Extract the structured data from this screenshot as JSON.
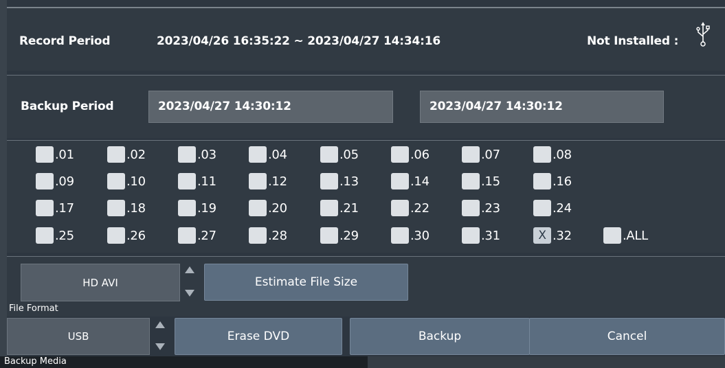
{
  "record": {
    "label": "Record Period",
    "period": "2023/04/26 16:35:22 ~ 2023/04/27 14:34:16",
    "usb_status": "Not Installed :",
    "usb_icon": "usb-icon"
  },
  "backup": {
    "label": "Backup Period",
    "start": "2023/04/27 14:30:12",
    "end": "2023/04/27 14:30:12"
  },
  "channels": {
    "items": [
      {
        "label": ".01",
        "mark": ""
      },
      {
        "label": ".02",
        "mark": ""
      },
      {
        "label": ".03",
        "mark": ""
      },
      {
        "label": ".04",
        "mark": ""
      },
      {
        "label": ".05",
        "mark": ""
      },
      {
        "label": ".06",
        "mark": ""
      },
      {
        "label": ".07",
        "mark": ""
      },
      {
        "label": ".08",
        "mark": ""
      },
      {
        "label": ".09",
        "mark": ""
      },
      {
        "label": ".10",
        "mark": ""
      },
      {
        "label": ".11",
        "mark": ""
      },
      {
        "label": ".12",
        "mark": ""
      },
      {
        "label": ".13",
        "mark": ""
      },
      {
        "label": ".14",
        "mark": ""
      },
      {
        "label": ".15",
        "mark": ""
      },
      {
        "label": ".16",
        "mark": ""
      },
      {
        "label": ".17",
        "mark": ""
      },
      {
        "label": ".18",
        "mark": ""
      },
      {
        "label": ".19",
        "mark": ""
      },
      {
        "label": ".20",
        "mark": ""
      },
      {
        "label": ".21",
        "mark": ""
      },
      {
        "label": ".22",
        "mark": ""
      },
      {
        "label": ".23",
        "mark": ""
      },
      {
        "label": ".24",
        "mark": ""
      },
      {
        "label": ".25",
        "mark": ""
      },
      {
        "label": ".26",
        "mark": ""
      },
      {
        "label": ".27",
        "mark": ""
      },
      {
        "label": ".28",
        "mark": ""
      },
      {
        "label": ".29",
        "mark": ""
      },
      {
        "label": ".30",
        "mark": ""
      },
      {
        "label": ".31",
        "mark": ""
      },
      {
        "label": ".32",
        "mark": "X"
      }
    ],
    "all": {
      "label": ".ALL",
      "mark": ""
    }
  },
  "file_format": {
    "value": "HD AVI",
    "label": "File Format",
    "estimate_button": "Estimate File Size"
  },
  "backup_media": {
    "value": "USB",
    "label": "Backup Media"
  },
  "buttons": {
    "erase": "Erase DVD",
    "backup": "Backup",
    "cancel": "Cancel"
  },
  "colors": {
    "background": "#2d3640",
    "panel": "#313a43",
    "field": "#5c646c",
    "button": "#5b6d80",
    "checkbox": "#dde1e5"
  }
}
